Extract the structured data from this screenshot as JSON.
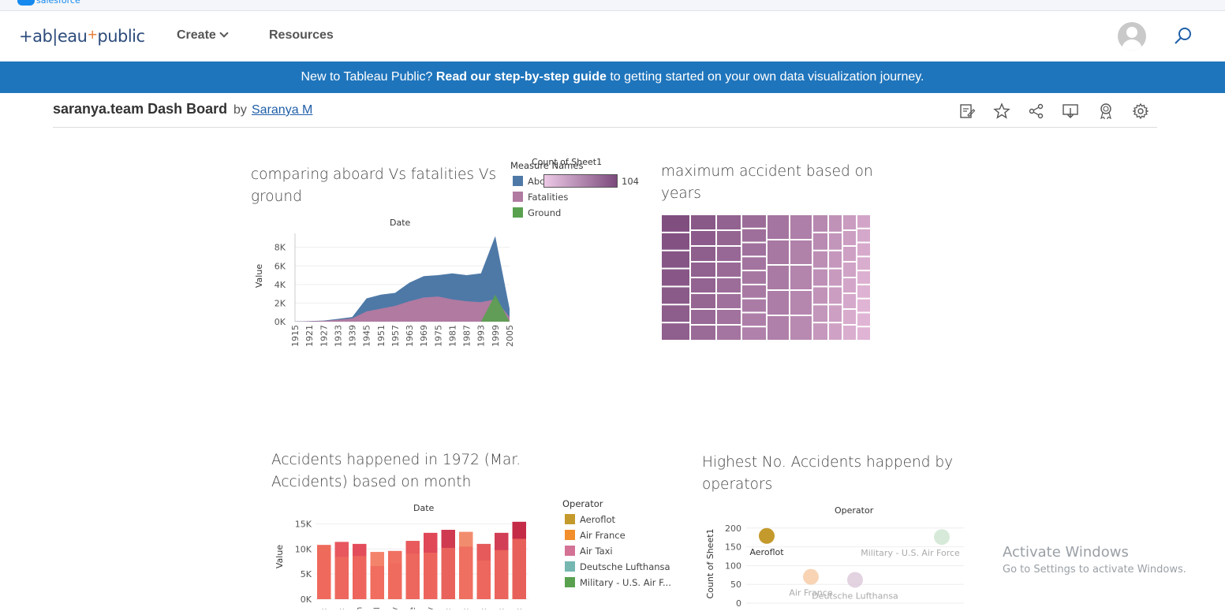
{
  "salesforce_strip": {
    "label": "salesforce"
  },
  "nav": {
    "logo": {
      "left": "+ab|eau",
      "plus": "+",
      "right": "public"
    },
    "create": "Create",
    "resources": "Resources"
  },
  "banner": {
    "prefix": "New to Tableau Public? ",
    "link": "Read our step-by-step guide",
    "suffix": " to getting started on your own data visualization journey."
  },
  "viz": {
    "title": "saranya.team Dash Board",
    "by": "by",
    "author": "Saranya M"
  },
  "sheets": {
    "area": {
      "title_line1": "comparing aboard Vs fatalities Vs",
      "title_line2": "ground",
      "x_header": "Date",
      "y_label": "Value",
      "legend_title": "Measure Names",
      "legend": [
        "Abc",
        "Fatalities",
        "Ground"
      ],
      "color_legend_title": "Count of Sheet1",
      "color_legend_max": "104"
    },
    "treemap": {
      "title_line1": "maximum accident based on",
      "title_line2": "years"
    },
    "bars": {
      "title_line1": "Accidents happened in 1972 (Mar.",
      "title_line2": "Accidents) based on month",
      "x_header": "Date",
      "y_label": "Value",
      "legend_title": "Operator",
      "legend": [
        "Aeroflot",
        "Air France",
        "Air Taxi",
        "Deutsche Lufthansa",
        "Military - U.S. Air F..."
      ]
    },
    "bubbles": {
      "title_line1": "Highest No. Accidents happend by",
      "title_line2": "operators",
      "x_header": "Operator",
      "y_label": "Count of Sheet1"
    }
  },
  "watermark": {
    "line1": "Activate Windows",
    "line2": "Go to Settings to activate Windows."
  },
  "colors": {
    "banner": "#1f75bc",
    "aboard": "#4e79a7",
    "fatalities": "#b07aa1",
    "ground": "#59a14f",
    "treemap_dark": "#7b4a7c",
    "treemap_light": "#e0b4d4"
  },
  "chart_data": [
    {
      "type": "area",
      "title": "comparing aboard Vs fatalities Vs ground",
      "xlabel": "Date",
      "ylabel": "Value",
      "x_ticks": [
        "1915",
        "1921",
        "1927",
        "1933",
        "1939",
        "1945",
        "1951",
        "1957",
        "1963",
        "1969",
        "1975",
        "1981",
        "1987",
        "1993",
        "1999",
        "2005"
      ],
      "y_ticks": [
        "0K",
        "2K",
        "4K",
        "6K",
        "8K"
      ],
      "ylim": [
        0,
        9500
      ],
      "series": [
        {
          "name": "Abc",
          "values": [
            20,
            60,
            120,
            300,
            500,
            2500,
            2900,
            3100,
            4200,
            4900,
            5000,
            5200,
            5000,
            5200,
            9200,
            1400
          ]
        },
        {
          "name": "Fatalities",
          "values": [
            15,
            40,
            80,
            200,
            350,
            1100,
            1400,
            1700,
            2200,
            2600,
            2700,
            2400,
            2200,
            2100,
            2400,
            500
          ]
        },
        {
          "name": "Ground",
          "values": [
            0,
            0,
            0,
            0,
            0,
            0,
            0,
            0,
            0,
            0,
            0,
            0,
            0,
            0,
            2900,
            0
          ]
        }
      ]
    },
    {
      "type": "heatmap",
      "title": "maximum accident based on years",
      "color_measure": "Count of Sheet1",
      "max": 104
    },
    {
      "type": "bar",
      "title": "Accidents happened in 1972 (Mar. Accidents) based on month",
      "xlabel": "Date",
      "ylabel": "Value",
      "categories": [
        "Jan",
        "Feb",
        "Mar",
        "Apr",
        "May",
        "Jun",
        "Jul",
        "Aug",
        "Sep",
        "Oct",
        "Nov",
        "Dec"
      ],
      "x_tick_labels": [
        ":",
        ":",
        "h",
        "il",
        "y",
        "e",
        "y",
        ":",
        ":",
        ":",
        ":",
        ":"
      ],
      "y_ticks": [
        "0K",
        "5K",
        "10K",
        "15K"
      ],
      "ylim": [
        0,
        16000
      ],
      "values": [
        10800,
        11400,
        11000,
        9400,
        9600,
        11600,
        13200,
        13800,
        13400,
        11000,
        13200,
        15400
      ]
    },
    {
      "type": "scatter",
      "title": "Highest No. Accidents happend by operators",
      "xlabel": "Operator",
      "ylabel": "Count of Sheet1",
      "y_ticks": [
        "0",
        "50",
        "100",
        "150",
        "200"
      ],
      "ylim": [
        0,
        210
      ],
      "points": [
        {
          "label": "Aeroflot",
          "y": 179
        },
        {
          "label": "Air France",
          "y": 70
        },
        {
          "label": "Deutsche Lufthansa",
          "y": 62
        },
        {
          "label": "Military - U.S. Air Force",
          "y": 176
        }
      ]
    }
  ]
}
